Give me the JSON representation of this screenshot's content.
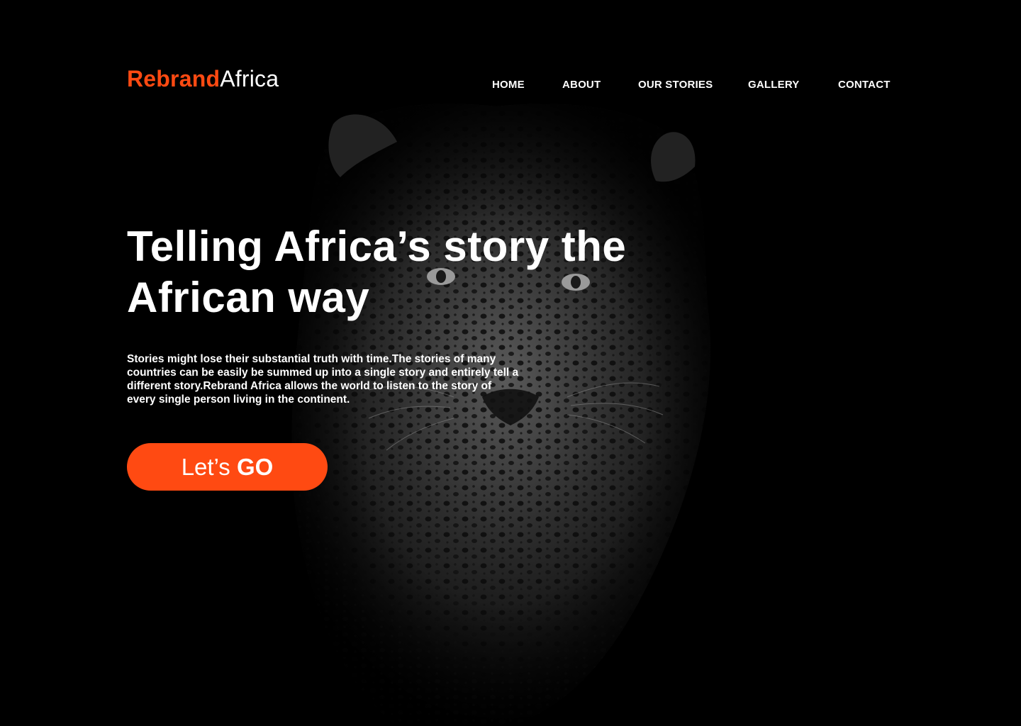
{
  "header": {
    "logo_brand": "Rebrand",
    "logo_region": "Africa",
    "nav": [
      {
        "label": "HOME"
      },
      {
        "label": "ABOUT"
      },
      {
        "label": "OUR STORIES"
      },
      {
        "label": "GALLERY"
      },
      {
        "label": "CONTACT"
      }
    ]
  },
  "hero": {
    "headline_line1": "Telling Africa’s story the",
    "headline_line2": "African way",
    "intro_line1": "Stories might lose their substantial truth with time.The stories of many",
    "intro_line2": "countries can be easily be summed up into a single story and entirely tell a",
    "intro_line3": "different story.Rebrand Africa allows the world to listen to the story of",
    "intro_line4": "every single person living in the continent.",
    "cta_light": "Let’s ",
    "cta_bold": "GO",
    "background_image": "leopard-face-monochrome"
  },
  "colors": {
    "accent": "#ff4a12",
    "background": "#000000",
    "text": "#ffffff"
  }
}
